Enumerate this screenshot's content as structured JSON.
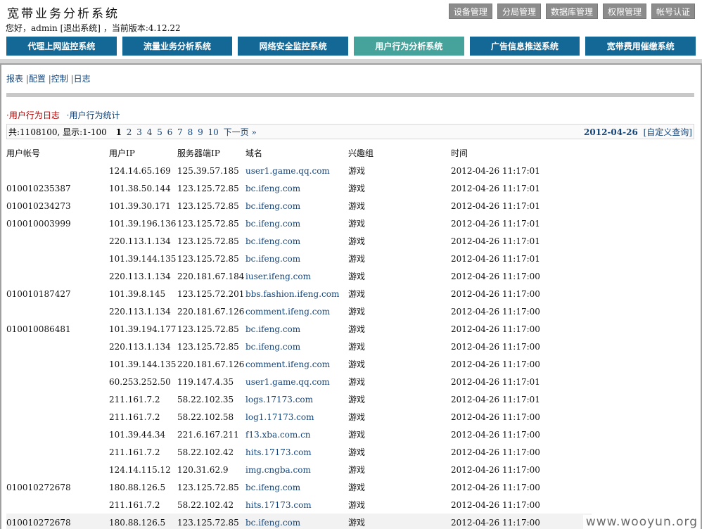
{
  "header": {
    "title": "宽带业务分析系统",
    "greeting_prefix": "您好，admin",
    "logout": "[退出系统]",
    "version": "，当前版本:4.12.22"
  },
  "top_buttons": [
    "设备管理",
    "分局管理",
    "数据库管理",
    "权限管理",
    "帐号认证"
  ],
  "nav": {
    "items": [
      "代理上网监控系统",
      "流量业务分析系统",
      "网络安全监控系统",
      "用户行为分析系统",
      "广告信息推送系统",
      "宽带费用催缴系统"
    ],
    "active_index": 3
  },
  "sublinks": [
    "报表",
    "配置",
    "控制",
    "日志"
  ],
  "subtabs": [
    "·用户行为日志",
    "·用户行为统计"
  ],
  "pager": {
    "summary": "共:1108100, 显示:1-100",
    "current": "1",
    "pages": [
      "2",
      "3",
      "4",
      "5",
      "6",
      "7",
      "8",
      "9",
      "10"
    ],
    "next": "下一页 »",
    "date": "2012-04-26",
    "custom_query": "[自定义查询]"
  },
  "table": {
    "columns": [
      "用户帐号",
      "用户IP",
      "服务器端IP",
      "域名",
      "兴趣组",
      "时间"
    ],
    "rows": [
      [
        "",
        "124.14.65.169",
        "125.39.57.185",
        "user1.game.qq.com",
        "游戏",
        "2012-04-26 11:17:01"
      ],
      [
        "010010235387",
        "101.38.50.144",
        "123.125.72.85",
        "bc.ifeng.com",
        "游戏",
        "2012-04-26 11:17:01"
      ],
      [
        "010010234273",
        "101.39.30.171",
        "123.125.72.85",
        "bc.ifeng.com",
        "游戏",
        "2012-04-26 11:17:01"
      ],
      [
        "010010003999",
        "101.39.196.136",
        "123.125.72.85",
        "bc.ifeng.com",
        "游戏",
        "2012-04-26 11:17:01"
      ],
      [
        "",
        "220.113.1.134",
        "123.125.72.85",
        "bc.ifeng.com",
        "游戏",
        "2012-04-26 11:17:01"
      ],
      [
        "",
        "101.39.144.135",
        "123.125.72.85",
        "bc.ifeng.com",
        "游戏",
        "2012-04-26 11:17:01"
      ],
      [
        "",
        "220.113.1.134",
        "220.181.67.184",
        "iuser.ifeng.com",
        "游戏",
        "2012-04-26 11:17:00"
      ],
      [
        "010010187427",
        "101.39.8.145",
        "123.125.72.201",
        "bbs.fashion.ifeng.com",
        "游戏",
        "2012-04-26 11:17:00"
      ],
      [
        "",
        "220.113.1.134",
        "220.181.67.126",
        "comment.ifeng.com",
        "游戏",
        "2012-04-26 11:17:00"
      ],
      [
        "010010086481",
        "101.39.194.177",
        "123.125.72.85",
        "bc.ifeng.com",
        "游戏",
        "2012-04-26 11:17:00"
      ],
      [
        "",
        "220.113.1.134",
        "123.125.72.85",
        "bc.ifeng.com",
        "游戏",
        "2012-04-26 11:17:00"
      ],
      [
        "",
        "101.39.144.135",
        "220.181.67.126",
        "comment.ifeng.com",
        "游戏",
        "2012-04-26 11:17:00"
      ],
      [
        "",
        "60.253.252.50",
        "119.147.4.35",
        "user1.game.qq.com",
        "游戏",
        "2012-04-26 11:17:01"
      ],
      [
        "",
        "211.161.7.2",
        "58.22.102.35",
        "logs.17173.com",
        "游戏",
        "2012-04-26 11:17:01"
      ],
      [
        "",
        "211.161.7.2",
        "58.22.102.58",
        "log1.17173.com",
        "游戏",
        "2012-04-26 11:17:00"
      ],
      [
        "",
        "101.39.44.34",
        "221.6.167.211",
        "f13.xba.com.cn",
        "游戏",
        "2012-04-26 11:17:00"
      ],
      [
        "",
        "211.161.7.2",
        "58.22.102.42",
        "hits.17173.com",
        "游戏",
        "2012-04-26 11:17:00"
      ],
      [
        "",
        "124.14.115.12",
        "120.31.62.9",
        "img.cngba.com",
        "游戏",
        "2012-04-26 11:17:00"
      ],
      [
        "010010272678",
        "180.88.126.5",
        "123.125.72.85",
        "bc.ifeng.com",
        "游戏",
        "2012-04-26 11:17:00"
      ],
      [
        "",
        "211.161.7.2",
        "58.22.102.42",
        "hits.17173.com",
        "游戏",
        "2012-04-26 11:17:00"
      ],
      [
        "010010272678",
        "180.88.126.5",
        "123.125.72.85",
        "bc.ifeng.com",
        "游戏",
        "2012-04-26 11:17:00"
      ]
    ]
  },
  "watermark": "www.wooyun.org"
}
